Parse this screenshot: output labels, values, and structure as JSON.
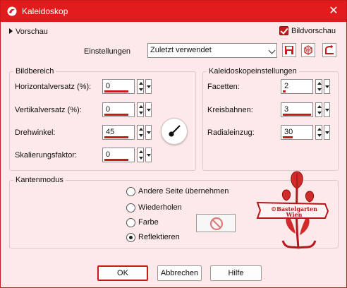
{
  "window": {
    "title": "Kaleidoskop"
  },
  "header": {
    "preview_toggle": "Vorschau",
    "preview_checkbox": {
      "label": "Bildvorschau",
      "checked": true
    },
    "settings_label": "Einstellungen",
    "settings_value": "Zuletzt verwendet"
  },
  "image_area": {
    "title": "Bildbereich",
    "fields": [
      {
        "label": "Horizontalversatz (%):",
        "value": "0"
      },
      {
        "label": "Vertikalversatz (%):",
        "value": "0"
      },
      {
        "label": "Drehwinkel:",
        "value": "45"
      },
      {
        "label": "Skalierungsfaktor:",
        "value": "0"
      }
    ]
  },
  "kaleido": {
    "title": "Kaleidoskopeinstellungen",
    "fields": [
      {
        "label": "Facetten:",
        "value": "2"
      },
      {
        "label": "Kreisbahnen:",
        "value": "3"
      },
      {
        "label": "Radialeinzug:",
        "value": "30"
      }
    ]
  },
  "edge_mode": {
    "title": "Kantenmodus",
    "options": [
      "Andere Seite übernehmen",
      "Wiederholen",
      "Farbe",
      "Reflektieren"
    ],
    "selected": "Reflektieren"
  },
  "watermark": {
    "line1": "©Bastelgarten",
    "line2": "Wien"
  },
  "buttons": {
    "ok": "OK",
    "cancel": "Abbrechen",
    "help": "Hilfe"
  },
  "colors": {
    "accent": "#e21c1c",
    "background": "#fde9e9"
  }
}
